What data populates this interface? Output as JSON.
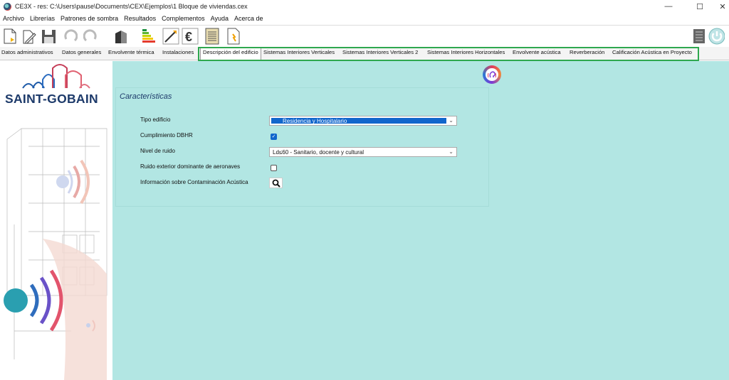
{
  "window": {
    "title": "CE3X - res: C:\\Users\\pause\\Documents\\CEX\\Ejemplos\\1 Bloque de viviendas.cex",
    "minimize": "—",
    "maximize": "☐",
    "close": "✕"
  },
  "menu": [
    "Archivo",
    "Librerías",
    "Patrones de sombra",
    "Resultados",
    "Complementos",
    "Ayuda",
    "Acerca de"
  ],
  "toolbar": {
    "icons": [
      "new-file-icon",
      "open-file-icon",
      "save-icon",
      "undo-icon",
      "redo-icon",
      "building-icon",
      "energy-rating-icon",
      "improvement-measures-icon",
      "euro-icon",
      "report-icon",
      "certificate-icon"
    ],
    "right_icons": [
      "calculator-icon",
      "power-icon"
    ]
  },
  "tabs": [
    {
      "label": "Datos administrativos",
      "active": false
    },
    {
      "label": "Datos generales",
      "active": false
    },
    {
      "label": "Envolvente térmica",
      "active": false
    },
    {
      "label": "Instalaciones",
      "active": false
    },
    {
      "label": "Descripción del edificio",
      "active": true
    },
    {
      "label": "Sistemas Interiores Verticales",
      "active": false
    },
    {
      "label": "Sistemas Interiores Verticales 2",
      "active": false
    },
    {
      "label": "Sistemas Interiores Horizontales",
      "active": false
    },
    {
      "label": "Envolvente acústica",
      "active": false
    },
    {
      "label": "Reverberación",
      "active": false
    },
    {
      "label": "Calificación Acústica en Proyecto",
      "active": false
    }
  ],
  "sidebar": {
    "brand": "SAINT-GOBAIN"
  },
  "form": {
    "section_title": "Características",
    "tipo_edificio_label": "Tipo edificio",
    "tipo_edificio_value": "Residencia y Hospitalario",
    "cumplimiento_label": "Cumplimiento DBHR",
    "cumplimiento_checked": true,
    "nivel_ruido_label": "Nivel de ruido",
    "nivel_ruido_value": "Ld≤60 - Sanitario, docente y cultural",
    "ruido_aeronaves_label": "Ruido exterior dominante de aeronaves",
    "ruido_aeronaves_checked": false,
    "info_contaminacion_label": "Información sobre Contaminación Acústica"
  },
  "colors": {
    "content_bg": "#b2e6e3",
    "selection_blue": "#1166cc",
    "tab_highlight": "#2fa84f",
    "brand_navy": "#1d3a6a"
  }
}
